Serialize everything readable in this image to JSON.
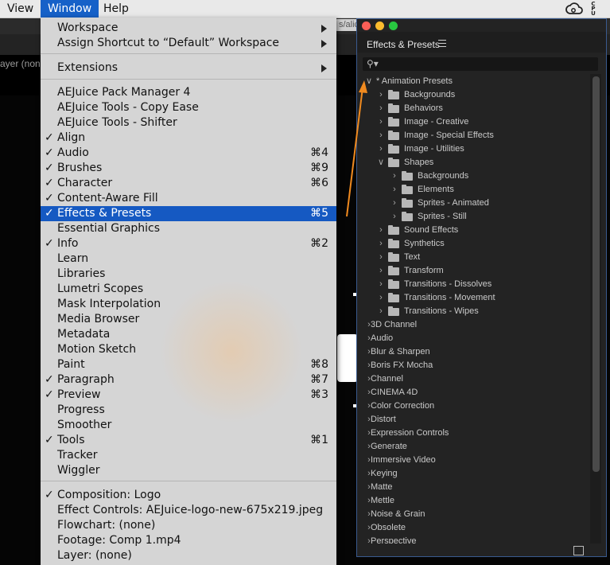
{
  "menubar": {
    "items": [
      "View",
      "Window",
      "Help"
    ],
    "active_index": 1
  },
  "workspace": {
    "path_fragment": "s/alic",
    "layer_label": "ayer (none"
  },
  "window_menu": {
    "items": [
      {
        "label": "Workspace",
        "submenu": true
      },
      {
        "label": "Assign Shortcut to “Default” Workspace",
        "submenu": true
      },
      {
        "label": "Extensions",
        "submenu": true
      },
      {
        "label": "AEJuice Pack Manager 4"
      },
      {
        "label": "AEJuice Tools - Copy Ease"
      },
      {
        "label": "AEJuice Tools - Shifter"
      },
      {
        "label": "Align",
        "checked": true
      },
      {
        "label": "Audio",
        "checked": true,
        "shortcut": "⌘4"
      },
      {
        "label": "Brushes",
        "checked": true,
        "shortcut": "⌘9"
      },
      {
        "label": "Character",
        "checked": true,
        "shortcut": "⌘6"
      },
      {
        "label": "Content-Aware Fill",
        "checked": true
      },
      {
        "label": "Effects & Presets",
        "checked": true,
        "shortcut": "⌘5",
        "highlighted": true
      },
      {
        "label": "Essential Graphics"
      },
      {
        "label": "Info",
        "checked": true,
        "shortcut": "⌘2"
      },
      {
        "label": "Learn"
      },
      {
        "label": "Libraries"
      },
      {
        "label": "Lumetri Scopes"
      },
      {
        "label": "Mask Interpolation"
      },
      {
        "label": "Media Browser"
      },
      {
        "label": "Metadata"
      },
      {
        "label": "Motion Sketch"
      },
      {
        "label": "Paint",
        "shortcut": "⌘8"
      },
      {
        "label": "Paragraph",
        "checked": true,
        "shortcut": "⌘7"
      },
      {
        "label": "Preview",
        "checked": true,
        "shortcut": "⌘3"
      },
      {
        "label": "Progress"
      },
      {
        "label": "Smoother"
      },
      {
        "label": "Tools",
        "checked": true,
        "shortcut": "⌘1"
      },
      {
        "label": "Tracker"
      },
      {
        "label": "Wiggler"
      },
      {
        "label": "Composition: Logo",
        "checked": true
      },
      {
        "label": "Effect Controls: AEJuice-logo-new-675x219.jpeg"
      },
      {
        "label": "Flowchart: (none)"
      },
      {
        "label": "Footage: Comp 1.mp4"
      },
      {
        "label": "Layer: (none)"
      }
    ]
  },
  "panel": {
    "title": "Effects & Presets",
    "search_placeholder": "",
    "tree": [
      {
        "label": "* Animation Presets",
        "level": 0,
        "expanded": true,
        "folder": false
      },
      {
        "label": "Backgrounds",
        "level": 1,
        "folder": true
      },
      {
        "label": "Behaviors",
        "level": 1,
        "folder": true
      },
      {
        "label": "Image - Creative",
        "level": 1,
        "folder": true
      },
      {
        "label": "Image - Special Effects",
        "level": 1,
        "folder": true
      },
      {
        "label": "Image - Utilities",
        "level": 1,
        "folder": true
      },
      {
        "label": "Shapes",
        "level": 1,
        "folder": true,
        "expanded": true
      },
      {
        "label": "Backgrounds",
        "level": 2,
        "folder": true
      },
      {
        "label": "Elements",
        "level": 2,
        "folder": true
      },
      {
        "label": "Sprites - Animated",
        "level": 2,
        "folder": true
      },
      {
        "label": "Sprites - Still",
        "level": 2,
        "folder": true
      },
      {
        "label": "Sound Effects",
        "level": 1,
        "folder": true
      },
      {
        "label": "Synthetics",
        "level": 1,
        "folder": true
      },
      {
        "label": "Text",
        "level": 1,
        "folder": true
      },
      {
        "label": "Transform",
        "level": 1,
        "folder": true
      },
      {
        "label": "Transitions - Dissolves",
        "level": 1,
        "folder": true
      },
      {
        "label": "Transitions - Movement",
        "level": 1,
        "folder": true
      },
      {
        "label": "Transitions - Wipes",
        "level": 1,
        "folder": true
      },
      {
        "label": "3D Channel",
        "level": 0
      },
      {
        "label": "Audio",
        "level": 0
      },
      {
        "label": "Blur & Sharpen",
        "level": 0
      },
      {
        "label": "Boris FX Mocha",
        "level": 0
      },
      {
        "label": "Channel",
        "level": 0
      },
      {
        "label": "CINEMA 4D",
        "level": 0
      },
      {
        "label": "Color Correction",
        "level": 0
      },
      {
        "label": "Distort",
        "level": 0
      },
      {
        "label": "Expression Controls",
        "level": 0
      },
      {
        "label": "Generate",
        "level": 0
      },
      {
        "label": "Immersive Video",
        "level": 0
      },
      {
        "label": "Keying",
        "level": 0
      },
      {
        "label": "Matte",
        "level": 0
      },
      {
        "label": "Mettle",
        "level": 0
      },
      {
        "label": "Noise & Grain",
        "level": 0
      },
      {
        "label": "Obsolete",
        "level": 0
      },
      {
        "label": "Perspective",
        "level": 0
      }
    ]
  },
  "colors": {
    "menu_highlight": "#1559c2",
    "annotation": "#f08a1f",
    "panel_bg": "#232323"
  }
}
